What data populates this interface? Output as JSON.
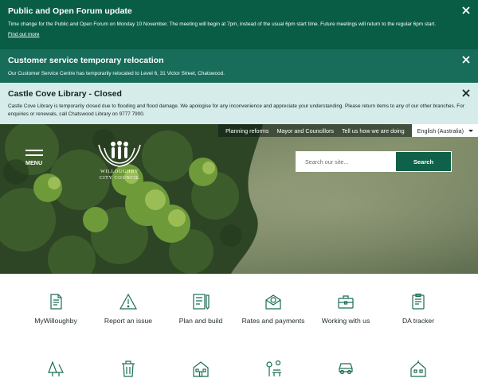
{
  "alerts": [
    {
      "title": "Public and Open Forum update",
      "body": "Time change for the Public and Open Forum on Monday 10 November. The meeting will begin at 7pm, instead of the usual 6pm start time. Future meetings will return to the regular 6pm start.",
      "link": "Find out more"
    },
    {
      "title": "Customer service temporary relocation",
      "body": "Our Customer Service Centre has temporarily relocated to Level 6, 31 Victor Street, Chatswood."
    },
    {
      "title": "Castle Cove Library - Closed",
      "body": "Castle Cove Library is temporarily closed due to flooding and flood damage. We apologise for any inconvenience and appreciate your understanding. Please return items to any of our other branches. For enquiries or renewals, call Chatswood Library on 9777 7900."
    }
  ],
  "utility": {
    "links": [
      "Planning reforms",
      "Mayor and Councillors",
      "Tell us how we are doing"
    ],
    "language": "English (Australia)"
  },
  "header": {
    "menu_label": "MENU",
    "logo_line1": "WILLOUGHBY",
    "logo_line2": "CITY COUNCIL"
  },
  "search": {
    "placeholder": "Search our site...",
    "button": "Search"
  },
  "colors": {
    "primary": "#0a5d45",
    "secondary": "#176d59",
    "info": "#d6ecea",
    "icon": "#1b6d57"
  },
  "quick_links": [
    {
      "label": "MyWilloughby",
      "icon": "document-icon"
    },
    {
      "label": "Report an issue",
      "icon": "warning-icon"
    },
    {
      "label": "Plan and build",
      "icon": "plans-icon"
    },
    {
      "label": "Rates and payments",
      "icon": "money-envelope-icon"
    },
    {
      "label": "Working with us",
      "icon": "briefcase-icon"
    },
    {
      "label": "DA tracker",
      "icon": "clipboard-icon"
    },
    {
      "label": "",
      "icon": "trees-icon"
    },
    {
      "label": "",
      "icon": "bin-icon"
    },
    {
      "label": "",
      "icon": "building-icon"
    },
    {
      "label": "",
      "icon": "park-icon"
    },
    {
      "label": "",
      "icon": "car-icon"
    },
    {
      "label": "",
      "icon": "house-icon"
    }
  ]
}
